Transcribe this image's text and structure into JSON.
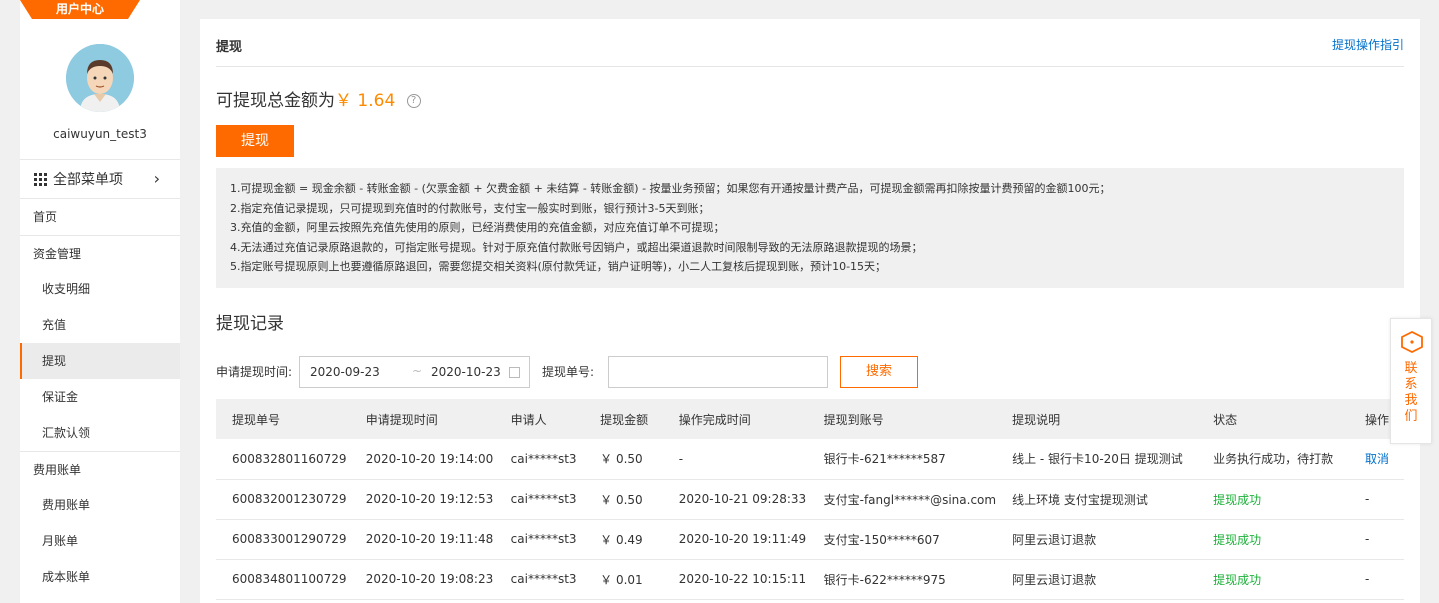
{
  "sidebar": {
    "banner": "用户中心",
    "username": "caiwuyun_test3",
    "all_menu_label": "全部菜单项",
    "nav": [
      {
        "label": "首页",
        "type": "section"
      },
      {
        "label": "资金管理",
        "type": "section"
      },
      {
        "label": "收支明细",
        "type": "sub"
      },
      {
        "label": "充值",
        "type": "sub"
      },
      {
        "label": "提现",
        "type": "sub",
        "active": true
      },
      {
        "label": "保证金",
        "type": "sub"
      },
      {
        "label": "汇款认领",
        "type": "sub"
      },
      {
        "label": "费用账单",
        "type": "section"
      },
      {
        "label": "费用账单",
        "type": "sub"
      },
      {
        "label": "月账单",
        "type": "sub"
      },
      {
        "label": "成本账单",
        "type": "sub"
      }
    ]
  },
  "main": {
    "title": "提现",
    "guide_link": "提现操作指引",
    "total_label": "可提现总金额为",
    "total_amount": "￥ 1.64",
    "help_icon": "?",
    "withdraw_button": "提现",
    "notes": [
      "1.可提现金额 = 现金余额 - 转账金额 - (欠票金额 + 欠费金额 + 未结算 - 转账金额) - 按量业务预留；如果您有开通按量计费产品，可提现金额需再扣除按量计费预留的金额100元；",
      "2.指定充值记录提现，只可提现到充值时的付款账号，支付宝一般实时到账，银行预计3-5天到账；",
      "3.充值的金额，阿里云按照先充值先使用的原则，已经消费使用的充值金额，对应充值订单不可提现；",
      "4.无法通过充值记录原路退款的，可指定账号提现。针对于原充值付款账号因销户，或超出渠道退款时间限制导致的无法原路退款提现的场景；",
      "5.指定账号提现原则上也要遵循原路退回，需要您提交相关资料(原付款凭证，销户证明等)，小二人工复核后提现到账，预计10-15天；"
    ],
    "records_title": "提现记录",
    "filter": {
      "time_label": "申请提现时间:",
      "date_start": "2020-09-23",
      "date_sep": "~",
      "date_end": "2020-10-23",
      "order_label": "提现单号:",
      "order_value": "",
      "search_button": "搜索"
    },
    "table": {
      "headers": [
        "提现单号",
        "申请提现时间",
        "申请人",
        "提现金额",
        "操作完成时间",
        "提现到账号",
        "提现说明",
        "状态",
        "操作"
      ],
      "rows": [
        [
          "600832801160729",
          "2020-10-20 19:14:00",
          "cai*****st3",
          "￥ 0.50",
          "-",
          "银行卡-621******587",
          "线上 - 银行卡10-20日 提现测试",
          "业务执行成功，待打款",
          "取消"
        ],
        [
          "600832001230729",
          "2020-10-20 19:12:53",
          "cai*****st3",
          "￥ 0.50",
          "2020-10-21 09:28:33",
          "支付宝-fangl******@sina.com",
          "线上环境 支付宝提现测试",
          "提现成功",
          "-"
        ],
        [
          "600833001290729",
          "2020-10-20 19:11:48",
          "cai*****st3",
          "￥ 0.49",
          "2020-10-20 19:11:49",
          "支付宝-150*****607",
          "阿里云退订退款",
          "提现成功",
          "-"
        ],
        [
          "600834801100729",
          "2020-10-20 19:08:23",
          "cai*****st3",
          "￥ 0.01",
          "2020-10-22 10:15:11",
          "银行卡-622******975",
          "阿里云退订退款",
          "提现成功",
          "-"
        ]
      ]
    }
  },
  "contact": {
    "label": "联系我们",
    "icon": "chat-icon"
  },
  "colors": {
    "accent": "#ff6a00",
    "amount": "#ff8a00",
    "success": "#1db13a",
    "link": "#0070cc"
  }
}
